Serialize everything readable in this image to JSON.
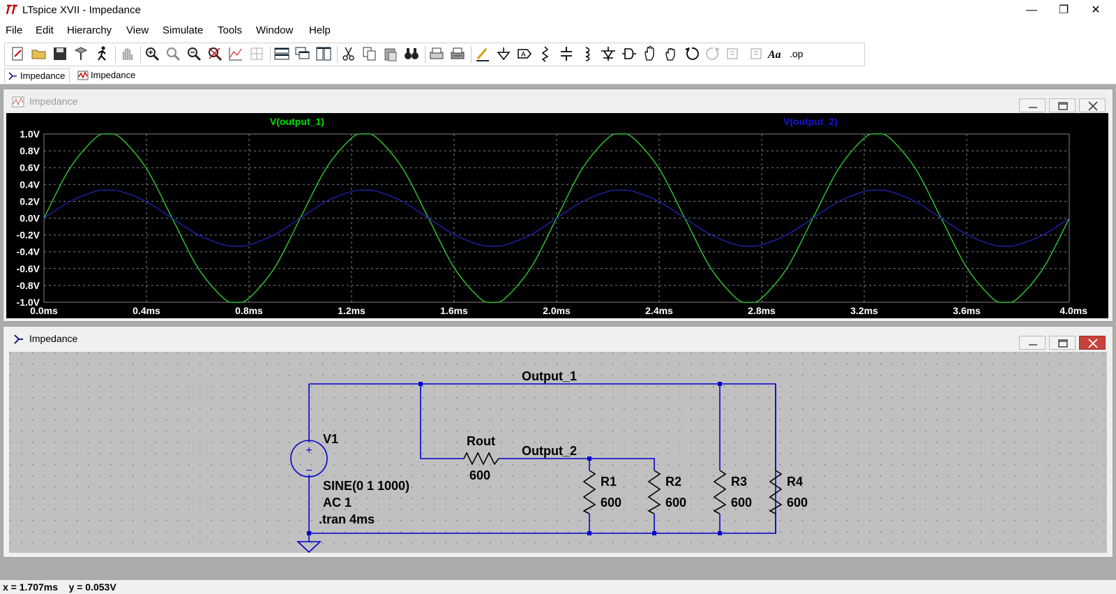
{
  "window": {
    "title": "LTspice XVII - Impedance",
    "minimize_glyph": "—",
    "maximize_glyph": "❐",
    "close_glyph": "✕"
  },
  "menu": [
    {
      "label": "File"
    },
    {
      "label": "Edit"
    },
    {
      "label": "Hierarchy"
    },
    {
      "label": "View"
    },
    {
      "label": "Simulate"
    },
    {
      "label": "Tools"
    },
    {
      "label": "Window"
    },
    {
      "label": "Help"
    }
  ],
  "toolbar": {
    "icons": [
      "new-schematic-icon",
      "open-icon",
      "save-icon",
      "control-panel-icon",
      "run-icon",
      "halt-icon",
      "zoom-in-icon",
      "zoom-area-icon",
      "zoom-out-icon",
      "zoom-fit-icon",
      "autorange-icon",
      "grid-icon",
      "tile-horizontal-icon",
      "cascade-icon",
      "tile-vertical-icon",
      "cut-icon",
      "copy-icon",
      "paste-icon",
      "find-icon",
      "print-icon",
      "print-setup-icon",
      "draw-wire-icon",
      "ground-icon",
      "label-net-icon",
      "resistor-icon",
      "capacitor-icon",
      "inductor-icon",
      "diode-icon",
      "component-icon",
      "move-icon",
      "drag-icon",
      "undo-icon",
      "redo-icon",
      "rotate-icon",
      "mirror-icon",
      "text-icon",
      "spice-directive-icon"
    ]
  },
  "tabs": [
    {
      "label": "Impedance",
      "icon": "schematic-icon"
    },
    {
      "label": "Impedance",
      "icon": "waveform-icon"
    }
  ],
  "plot_window": {
    "title": "Impedance",
    "trace_labels": [
      {
        "text": "V(output_1)",
        "color": "#00ff00"
      },
      {
        "text": "V(output_2)",
        "color": "#0000ff"
      }
    ],
    "colors": {
      "background": "#000000",
      "grid": "#808080",
      "axis_text": "#ffffff"
    }
  },
  "chart_data": {
    "type": "line",
    "title": "",
    "x_unit": "ms",
    "y_unit": "V",
    "xlim": [
      0,
      4
    ],
    "ylim": [
      -1,
      1
    ],
    "x_ticks": [
      "0.0ms",
      "0.4ms",
      "0.8ms",
      "1.2ms",
      "1.6ms",
      "2.0ms",
      "2.4ms",
      "2.8ms",
      "3.2ms",
      "3.6ms",
      "4.0ms"
    ],
    "y_ticks": [
      "1.0V",
      "0.8V",
      "0.6V",
      "0.4V",
      "0.2V",
      "0.0V",
      "-0.2V",
      "-0.4V",
      "-0.6V",
      "-0.8V",
      "-1.0V"
    ],
    "grid": true,
    "series": [
      {
        "name": "V(output_1)",
        "color": "#35d335",
        "x": [
          0.0,
          0.1,
          0.2,
          0.25,
          0.3,
          0.4,
          0.5,
          0.6,
          0.7,
          0.75,
          0.8,
          0.9,
          1.0,
          1.1,
          1.2,
          1.25,
          1.3,
          1.4,
          1.5,
          1.6,
          1.7,
          1.75,
          1.8,
          1.9,
          2.0,
          2.1,
          2.2,
          2.25,
          2.3,
          2.4,
          2.5,
          2.6,
          2.7,
          2.75,
          2.8,
          2.9,
          3.0,
          3.1,
          3.2,
          3.25,
          3.3,
          3.4,
          3.5,
          3.6,
          3.7,
          3.75,
          3.8,
          3.9,
          4.0
        ],
        "y": [
          0.0,
          0.588,
          0.951,
          1.0,
          0.951,
          0.588,
          0.0,
          -0.588,
          -0.951,
          -1.0,
          -0.951,
          -0.588,
          0.0,
          0.588,
          0.951,
          1.0,
          0.951,
          0.588,
          0.0,
          -0.588,
          -0.951,
          -1.0,
          -0.951,
          -0.588,
          0.0,
          0.588,
          0.951,
          1.0,
          0.951,
          0.588,
          0.0,
          -0.588,
          -0.951,
          -1.0,
          -0.951,
          -0.588,
          0.0,
          0.588,
          0.951,
          1.0,
          0.951,
          0.588,
          0.0,
          -0.588,
          -0.951,
          -1.0,
          -0.951,
          -0.588,
          0.0
        ]
      },
      {
        "name": "V(output_2)",
        "color": "#2323b8",
        "x": [
          0.0,
          0.1,
          0.2,
          0.25,
          0.3,
          0.4,
          0.5,
          0.6,
          0.7,
          0.75,
          0.8,
          0.9,
          1.0,
          1.1,
          1.2,
          1.25,
          1.3,
          1.4,
          1.5,
          1.6,
          1.7,
          1.75,
          1.8,
          1.9,
          2.0,
          2.1,
          2.2,
          2.25,
          2.3,
          2.4,
          2.5,
          2.6,
          2.7,
          2.75,
          2.8,
          2.9,
          3.0,
          3.1,
          3.2,
          3.25,
          3.3,
          3.4,
          3.5,
          3.6,
          3.7,
          3.75,
          3.8,
          3.9,
          4.0
        ],
        "y": [
          0.0,
          0.196,
          0.317,
          0.333,
          0.317,
          0.196,
          0.0,
          -0.196,
          -0.317,
          -0.333,
          -0.317,
          -0.196,
          0.0,
          0.196,
          0.317,
          0.333,
          0.317,
          0.196,
          0.0,
          -0.196,
          -0.317,
          -0.333,
          -0.317,
          -0.196,
          0.0,
          0.196,
          0.317,
          0.333,
          0.317,
          0.196,
          0.0,
          -0.196,
          -0.317,
          -0.333,
          -0.317,
          -0.196,
          0.0,
          0.196,
          0.317,
          0.333,
          0.317,
          0.196,
          0.0,
          -0.196,
          -0.317,
          -0.333,
          -0.317,
          -0.196,
          0.0
        ]
      }
    ]
  },
  "schematic_window": {
    "title": "Impedance",
    "colors": {
      "background": "#c0c0c0",
      "wire": "#0000cd",
      "text": "#000000"
    },
    "nets": {
      "output_1": "Output_1",
      "output_2": "Output_2"
    },
    "source": {
      "name": "V1",
      "value": "SINE(0 1 1000)",
      "ac": "AC 1",
      "plus": "+",
      "minus": "−"
    },
    "directive": ".tran 4ms",
    "resistors": [
      {
        "name": "Rout",
        "value": "600"
      },
      {
        "name": "R1",
        "value": "600"
      },
      {
        "name": "R2",
        "value": "600"
      },
      {
        "name": "R3",
        "value": "600"
      },
      {
        "name": "R4",
        "value": "600"
      }
    ]
  },
  "status": {
    "cursor": "x = 1.707ms    y = 0.053V"
  }
}
